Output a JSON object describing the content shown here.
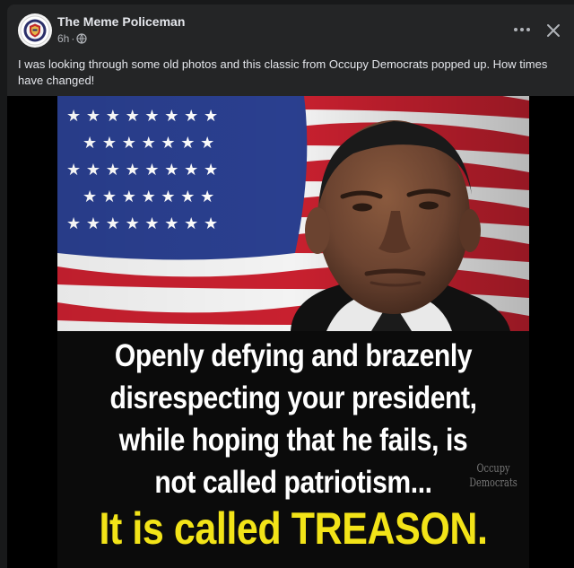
{
  "post": {
    "author": "The Meme Policeman",
    "time": "6h",
    "separator": "·",
    "audience_icon": "globe-icon",
    "caption": "I was looking through some old photos and this classic from Occupy Democrats popped up. How times have changed!",
    "more_icon": "more-options-icon",
    "close_icon": "close-icon"
  },
  "meme": {
    "lines": [
      "Openly defying and brazenly",
      "disrespecting your president,",
      "while hoping that he fails, is",
      "not called patriotism..."
    ],
    "punchline": "It is called TREASON.",
    "watermark_line1": "Occupy",
    "watermark_line2": "Democrats"
  },
  "colors": {
    "card_bg": "#242526",
    "text_primary": "#e4e6eb",
    "text_secondary": "#b0b3b8",
    "punch_yellow": "#f2e318"
  }
}
